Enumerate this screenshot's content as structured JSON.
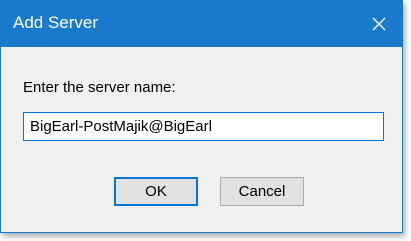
{
  "window": {
    "title": "Add Server",
    "close_icon": "close-icon"
  },
  "form": {
    "prompt": "Enter the server name:",
    "server_name_value": "BigEarl-PostMajik@BigEarl"
  },
  "buttons": {
    "ok_label": "OK",
    "cancel_label": "Cancel"
  },
  "colors": {
    "titlebar": "#1979ca",
    "accent": "#0078d7",
    "dialog_bg": "#f0f0f0"
  }
}
